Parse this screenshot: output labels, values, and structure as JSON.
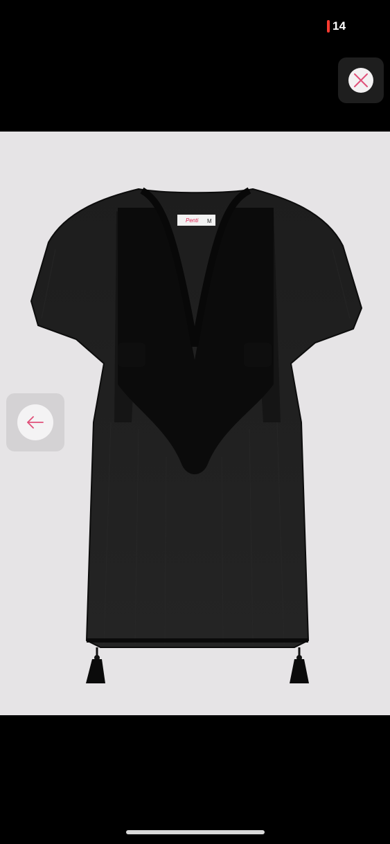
{
  "status_bar": {
    "battery_text": "14",
    "battery_color": "#ff3b30"
  },
  "controls": {
    "close_icon": "close-icon",
    "prev_icon": "arrow-left-icon",
    "accent": "#e05079"
  },
  "product": {
    "image_description": "",
    "label_brand": "Penti",
    "label_size": "M",
    "garment_color": "#111111"
  }
}
